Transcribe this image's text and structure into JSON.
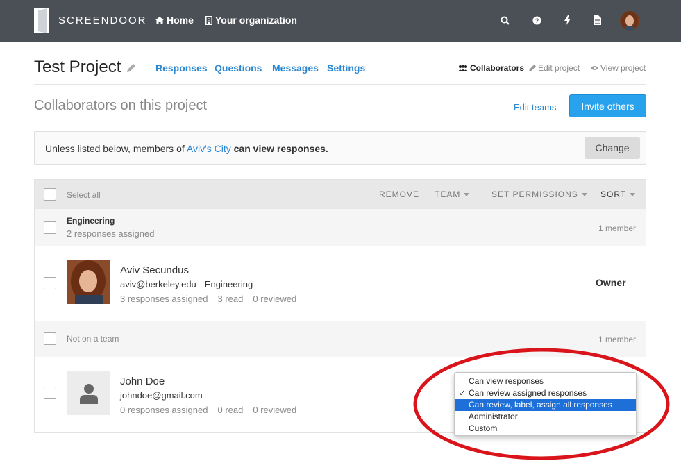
{
  "topbar": {
    "logo_text": "SCREENDOOR",
    "home_label": "Home",
    "org_label": "Your organization",
    "icons": [
      "search-icon",
      "help-icon",
      "bolt-icon",
      "document-icon"
    ],
    "bg_color": "#4b4f56"
  },
  "project": {
    "title": "Test Project",
    "tabs": [
      "Responses",
      "Questions",
      "Messages",
      "Settings"
    ],
    "links": {
      "collaborators": "Collaborators",
      "edit": "Edit project",
      "view": "View project"
    }
  },
  "section": {
    "title": "Collaborators on this project",
    "edit_teams": "Edit teams",
    "invite": "Invite others"
  },
  "notice": {
    "prefix": "Unless listed below, members of ",
    "org": "Aviv's City",
    "suffix": " can view responses.",
    "change": "Change"
  },
  "table": {
    "select_all": "Select all",
    "remove": "REMOVE",
    "team": "TEAM",
    "set_permissions": "SET PERMISSIONS",
    "sort": "SORT",
    "groups": [
      {
        "name": "Engineering",
        "sub": "2 responses assigned",
        "count": "1 member"
      },
      {
        "name": "Not on a team",
        "sub": "",
        "count": "1 member"
      }
    ],
    "members": [
      {
        "name": "Aviv Secundus",
        "email": "aviv@berkeley.edu",
        "team": "Engineering",
        "assigned": "3 responses assigned",
        "read": "3 read",
        "reviewed": "0 reviewed",
        "role": "Owner"
      },
      {
        "name": "John Doe",
        "email": "johndoe@gmail.com",
        "team": "",
        "assigned": "0 responses assigned",
        "read": "0 read",
        "reviewed": "0 reviewed",
        "role": ""
      }
    ]
  },
  "permissions_dropdown": {
    "options": [
      "Can view responses",
      "Can review assigned responses",
      "Can review, label, assign all responses",
      "Administrator",
      "Custom"
    ],
    "checked": "Can review assigned responses",
    "highlighted": "Can review, label, assign all responses",
    "highlight_color": "#1e6fd8"
  },
  "colors": {
    "accent": "#29a2ee",
    "link": "#2b87d1",
    "annotation": "#d9141b"
  }
}
